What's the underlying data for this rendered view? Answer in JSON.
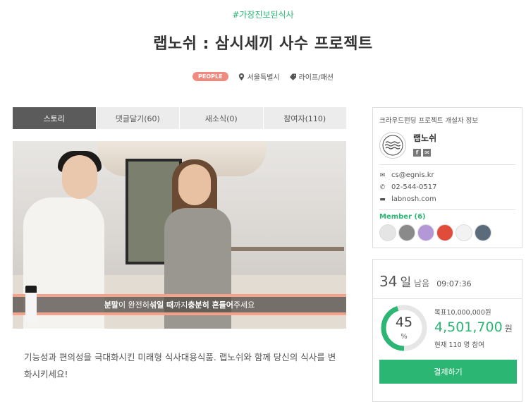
{
  "hashtag": "#가장진보된식사",
  "title": "랩노쉬 : 삼시세끼 사수 프로젝트",
  "meta": {
    "badge": "PEOPLE",
    "location": "서울특별시",
    "category": "라이프/패션"
  },
  "tabs": [
    {
      "label": "스토리",
      "active": true
    },
    {
      "label": "댓글달기(60)",
      "active": false
    },
    {
      "label": "새소식(0)",
      "active": false
    },
    {
      "label": "참여자(110)",
      "active": false
    }
  ],
  "video": {
    "subtitle_parts": [
      "분말",
      "이 완전히 ",
      "섞일 때",
      "까지 ",
      "충분히 흔들어",
      "주세요"
    ]
  },
  "description": "기능성과 편의성을 극대화시킨 미래형 식사대용식품. 랩노쉬와 함께 당신의 식사를 변화시키세요!",
  "creator": {
    "header": "크라우드펀딩 프로젝트 개설자 정보",
    "name": "랩노쉬",
    "email": "cs@egnis.kr",
    "phone": "02-544-0517",
    "website": "labnosh.com",
    "member_label": "Member (6)",
    "member_count": 6
  },
  "funding": {
    "days": "34",
    "days_unit": "일",
    "days_suffix": "남음",
    "time_left": "09:07:36",
    "percent": "45",
    "percent_value": 45,
    "percent_sign": "%",
    "goal": "목표10,000,000원",
    "amount": "4,501,700",
    "amount_unit": "원",
    "participants": "현재 110 명 참여",
    "button": "결제하기"
  },
  "colors": {
    "accent": "#2bb673",
    "badge": "#f08a7e",
    "active_tab": "#5b5b5b"
  }
}
